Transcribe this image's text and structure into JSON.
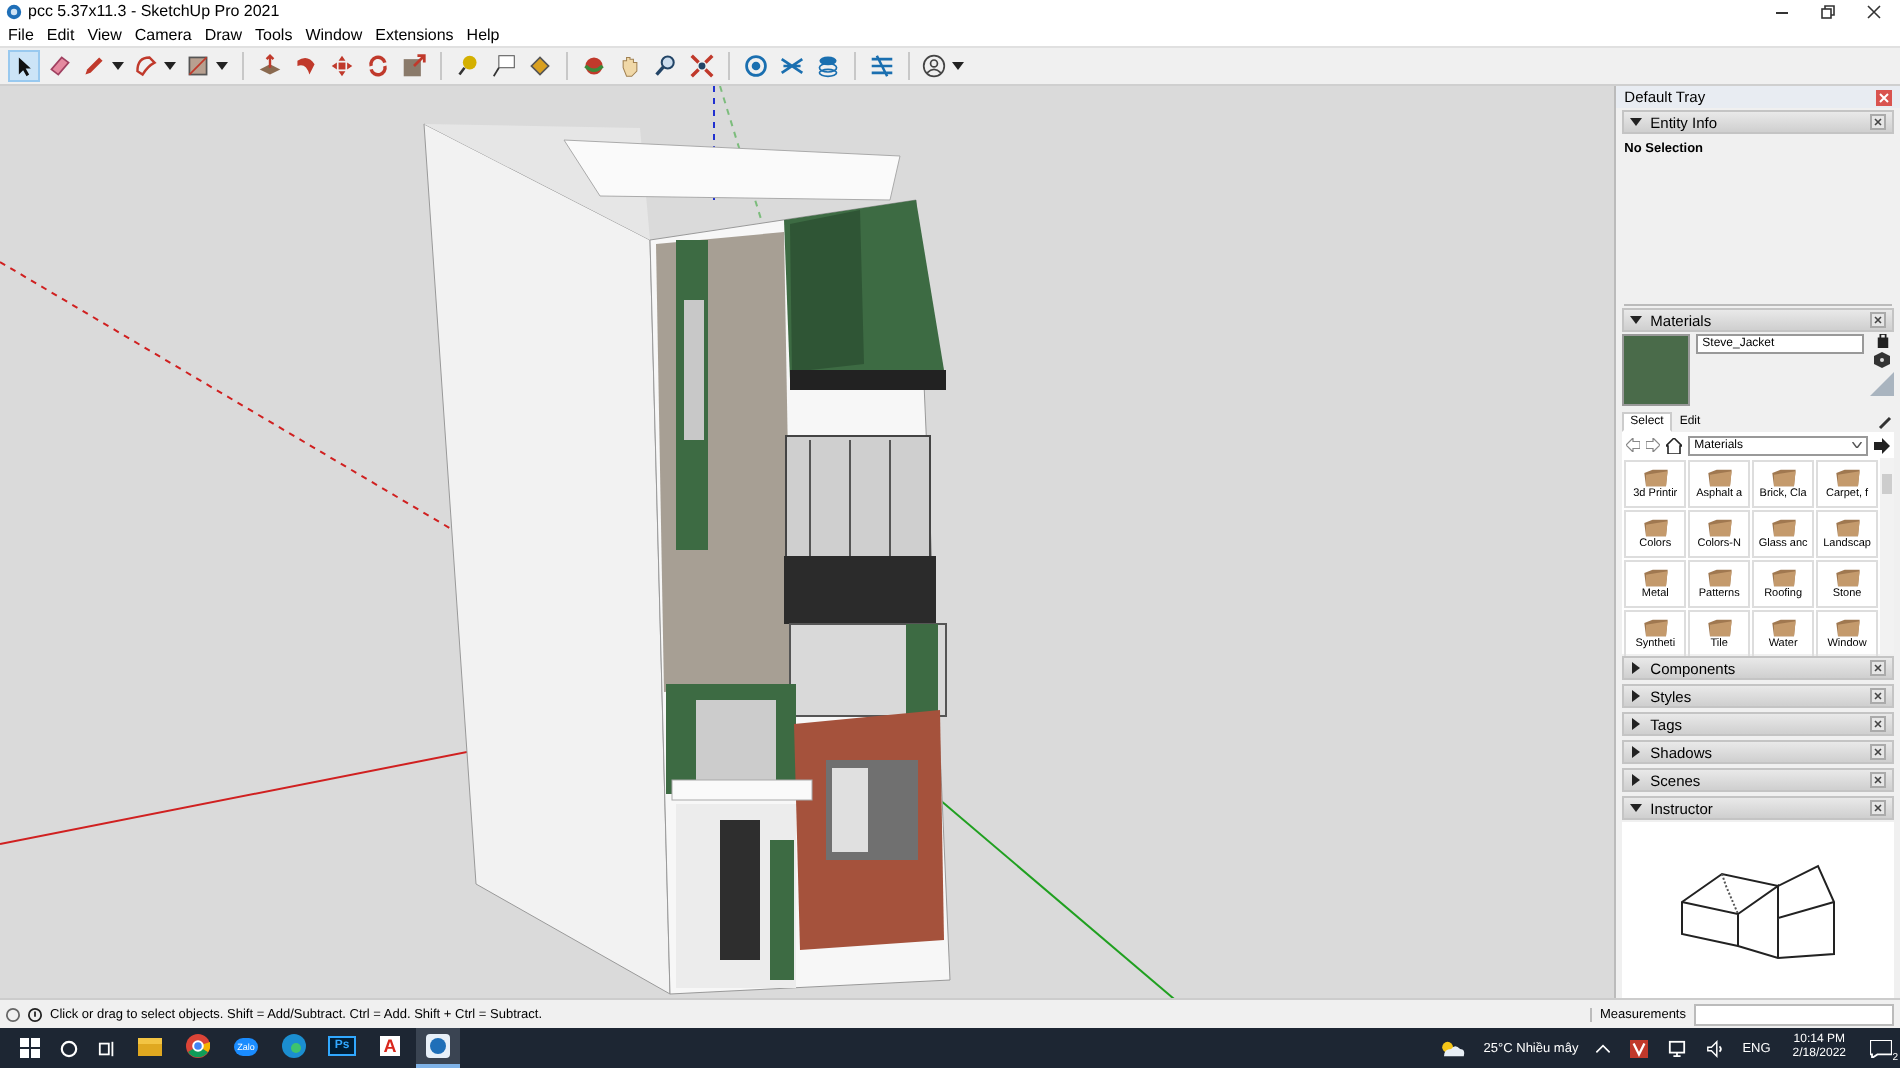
{
  "window": {
    "title": "pcc 5.37x11.3 - SketchUp Pro 2021"
  },
  "menu": [
    "File",
    "Edit",
    "View",
    "Camera",
    "Draw",
    "Tools",
    "Window",
    "Extensions",
    "Help"
  ],
  "toolbar": [
    [
      {
        "kind": "select",
        "selected": true,
        "dropdown": false
      },
      {
        "kind": "eraser",
        "selected": false,
        "dropdown": false
      },
      {
        "kind": "pencil",
        "selected": false,
        "dropdown": true
      },
      {
        "kind": "arc",
        "selected": false,
        "dropdown": true
      },
      {
        "kind": "rectangle",
        "selected": false,
        "dropdown": true
      }
    ],
    [
      {
        "kind": "pushpull",
        "selected": false,
        "dropdown": false
      },
      {
        "kind": "followme",
        "selected": false,
        "dropdown": false
      },
      {
        "kind": "move",
        "selected": false,
        "dropdown": false
      },
      {
        "kind": "rotate",
        "selected": false,
        "dropdown": false
      },
      {
        "kind": "scale",
        "selected": false,
        "dropdown": false
      }
    ],
    [
      {
        "kind": "tape",
        "selected": false,
        "dropdown": false
      },
      {
        "kind": "text",
        "selected": false,
        "dropdown": false
      },
      {
        "kind": "paint",
        "selected": false,
        "dropdown": false
      }
    ],
    [
      {
        "kind": "orbit",
        "selected": false,
        "dropdown": false
      },
      {
        "kind": "pan",
        "selected": false,
        "dropdown": false
      },
      {
        "kind": "zoom",
        "selected": false,
        "dropdown": false
      },
      {
        "kind": "extents",
        "selected": false,
        "dropdown": false
      }
    ],
    [
      {
        "kind": "warehouse",
        "selected": false,
        "dropdown": false
      },
      {
        "kind": "layers",
        "selected": false,
        "dropdown": false
      },
      {
        "kind": "stack",
        "selected": false,
        "dropdown": false
      }
    ],
    [
      {
        "kind": "extension",
        "selected": false,
        "dropdown": false
      }
    ],
    [
      {
        "kind": "account",
        "selected": false,
        "dropdown": true
      }
    ]
  ],
  "tray": {
    "title": "Default Tray",
    "panels": [
      {
        "kind": "entity_info",
        "title": "Entity Info",
        "expanded": true,
        "selection": "No Selection"
      },
      {
        "kind": "materials",
        "title": "Materials",
        "expanded": true,
        "material_name": "Steve_Jacket",
        "tabs": [
          {
            "label": "Select",
            "selected": true
          },
          {
            "label": "Edit",
            "selected": false
          }
        ],
        "library": "Materials",
        "items": [
          "3d Printir",
          "Asphalt a",
          "Brick, Cla",
          "Carpet, f",
          "Colors",
          "Colors-N",
          "Glass anc",
          "Landscap",
          "Metal",
          "Patterns",
          "Roofing",
          "Stone",
          "Syntheti",
          "Tile",
          "Water",
          "Window"
        ]
      },
      {
        "title": "Components",
        "expanded": false
      },
      {
        "title": "Styles",
        "expanded": false
      },
      {
        "title": "Tags",
        "expanded": false
      },
      {
        "title": "Shadows",
        "expanded": false
      },
      {
        "title": "Scenes",
        "expanded": false
      },
      {
        "kind": "instructor",
        "title": "Instructor",
        "expanded": true
      }
    ]
  },
  "status_bar": {
    "text": "Click or drag to select objects. Shift = Add/Subtract. Ctrl = Add. Shift + Ctrl = Subtract.",
    "measurements_label": "Measurements"
  },
  "taskbar": {
    "apps": [
      {
        "kind": "explorer",
        "active": false
      },
      {
        "kind": "chrome",
        "active": false
      },
      {
        "kind": "zalo",
        "label": "Zalo",
        "active": false
      },
      {
        "kind": "edge",
        "active": false
      },
      {
        "kind": "photoshop",
        "label": "Ps",
        "active": false
      },
      {
        "kind": "acrobat",
        "label": "A",
        "active": false
      },
      {
        "kind": "sketchup",
        "active": true
      }
    ],
    "weather": "25°C Nhiều mây",
    "language": "ENG",
    "time": "10:14 PM",
    "date": "2/18/2022",
    "notifications": "2"
  }
}
